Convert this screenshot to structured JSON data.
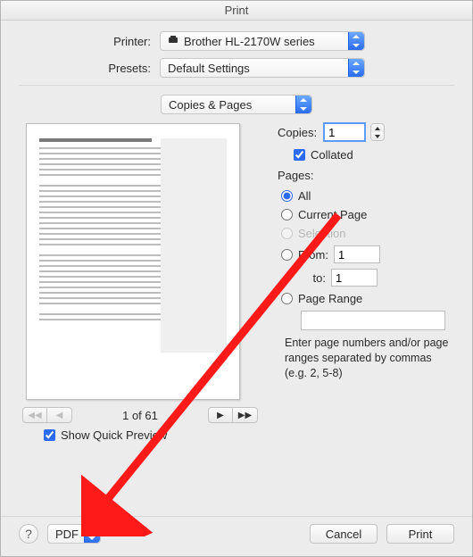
{
  "title": "Print",
  "header": {
    "printer_label": "Printer:",
    "printer_value": "Brother HL-2170W series",
    "presets_label": "Presets:",
    "presets_value": "Default Settings"
  },
  "section_popup": "Copies & Pages",
  "copies": {
    "label": "Copies:",
    "value": "1",
    "collated_label": "Collated",
    "collated_checked": true
  },
  "pages": {
    "label": "Pages:",
    "all": "All",
    "current": "Current Page",
    "selection": "Selection",
    "from_label": "From:",
    "from_value": "1",
    "to_label": "to:",
    "to_value": "1",
    "range_label": "Page Range",
    "range_value": "",
    "hint": "Enter page numbers and/or page ranges separated by commas (e.g. 2, 5-8)",
    "selected": "all"
  },
  "preview": {
    "page_indicator": "1 of 61",
    "show_quick_label": "Show Quick Preview",
    "show_quick_checked": true
  },
  "footer": {
    "pdf_label": "PDF",
    "cancel": "Cancel",
    "print": "Print"
  }
}
